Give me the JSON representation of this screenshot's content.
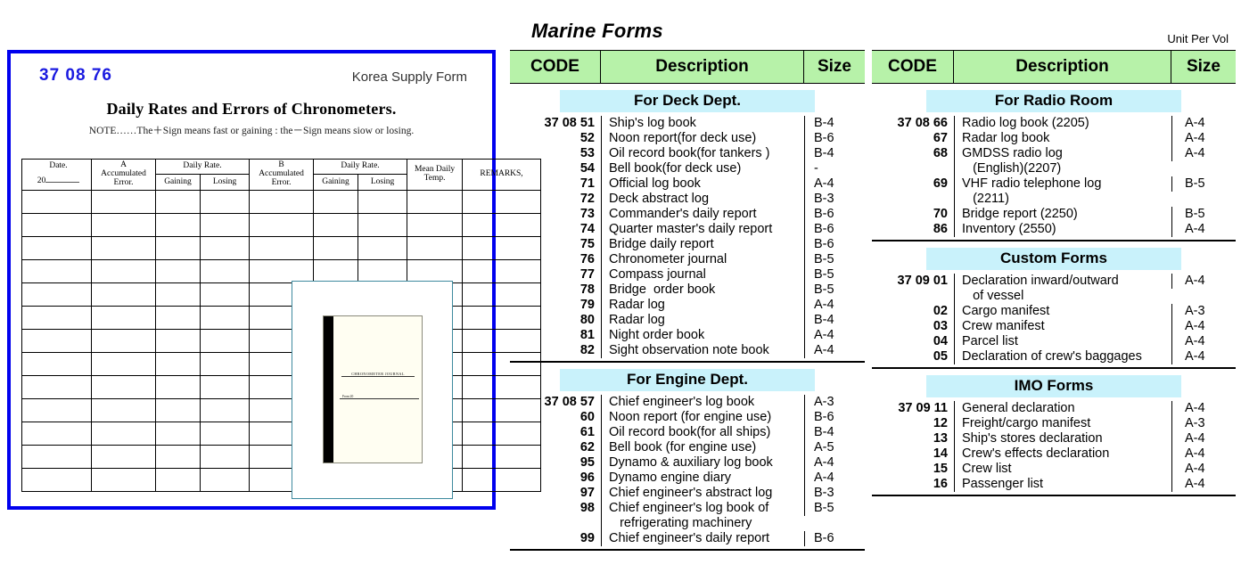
{
  "catalog": {
    "title": "Marine Forms",
    "unit_note": "Unit Per Vol",
    "columns": {
      "code": "CODE",
      "description": "Description",
      "size": "Size"
    },
    "sections": [
      {
        "band": "For Deck Dept.",
        "column": "middle",
        "rows": [
          {
            "code": "37 08 51",
            "description": "Ship's log book",
            "size": "B-4"
          },
          {
            "code": "52",
            "description": "Noon report(for deck use)",
            "size": "B-6"
          },
          {
            "code": "53",
            "description": "Oil record book(for tankers )",
            "size": "B-4"
          },
          {
            "code": "54",
            "description": "Bell book(for deck use)",
            "size": "-"
          },
          {
            "code": "71",
            "description": "Official log book",
            "size": "A-4"
          },
          {
            "code": "72",
            "description": "Deck abstract log",
            "size": "B-3"
          },
          {
            "code": "73",
            "description": "Commander's daily report",
            "size": "B-6"
          },
          {
            "code": "74",
            "description": "Quarter master's daily report",
            "size": "B-6"
          },
          {
            "code": "75",
            "description": "Bridge daily report",
            "size": "B-6"
          },
          {
            "code": "76",
            "description": "Chronometer journal",
            "size": "B-5"
          },
          {
            "code": "77",
            "description": "Compass journal",
            "size": "B-5"
          },
          {
            "code": "78",
            "description": "Bridge  order book",
            "size": "B-5"
          },
          {
            "code": "79",
            "description": "Radar log",
            "size": "A-4"
          },
          {
            "code": "80",
            "description": "Radar log",
            "size": "B-4"
          },
          {
            "code": "81",
            "description": "Night order book",
            "size": "A-4"
          },
          {
            "code": "82",
            "description": "Sight observation note book",
            "size": "A-4"
          }
        ]
      },
      {
        "band": "For Engine Dept.",
        "column": "middle",
        "rows": [
          {
            "code": "37 08 57",
            "description": "Chief engineer's log book",
            "size": "A-3"
          },
          {
            "code": "60",
            "description": "Noon report (for engine use)",
            "size": "B-6"
          },
          {
            "code": "61",
            "description": "Oil record book(for all ships)",
            "size": "B-4"
          },
          {
            "code": "62",
            "description": "Bell book (for engine use)",
            "size": "A-5"
          },
          {
            "code": "95",
            "description": "Dynamo & auxiliary log book",
            "size": "A-4"
          },
          {
            "code": "96",
            "description": "Dynamo engine diary",
            "size": "A-4"
          },
          {
            "code": "97",
            "description": "Chief engineer's abstract log",
            "size": "B-3"
          },
          {
            "code": "98",
            "description": "Chief engineer's log book of\n   refrigerating machinery",
            "size": "B-5"
          },
          {
            "code": "99",
            "description": "Chief engineer's daily report",
            "size": "B-6"
          }
        ]
      },
      {
        "band": "For Radio Room",
        "column": "right",
        "rows": [
          {
            "code": "37 08 66",
            "description": "Radio log book (2205)",
            "size": "A-4"
          },
          {
            "code": "67",
            "description": "Radar log book",
            "size": "A-4"
          },
          {
            "code": "68",
            "description": "GMDSS radio log\n   (English)(2207)",
            "size": "A-4"
          },
          {
            "code": "69",
            "description": "VHF radio telephone log\n   (2211)",
            "size": "B-5"
          },
          {
            "code": "70",
            "description": "Bridge report (2250)",
            "size": "B-5"
          },
          {
            "code": "86",
            "description": "Inventory (2550)",
            "size": "A-4"
          }
        ]
      },
      {
        "band": "Custom Forms",
        "column": "right",
        "rows": [
          {
            "code": "37 09 01",
            "description": "Declaration inward/outward\n   of vessel",
            "size": "A-4"
          },
          {
            "code": "02",
            "description": "Cargo manifest",
            "size": "A-3"
          },
          {
            "code": "03",
            "description": "Crew manifest",
            "size": "A-4"
          },
          {
            "code": "04",
            "description": "Parcel list",
            "size": "A-4"
          },
          {
            "code": "05",
            "description": "Declaration of crew's baggages",
            "size": "A-4"
          }
        ]
      },
      {
        "band": "IMO Forms",
        "column": "right",
        "rows": [
          {
            "code": "37 09 11",
            "description": "General declaration",
            "size": "A-4"
          },
          {
            "code": "12",
            "description": "Freight/cargo manifest",
            "size": "A-3"
          },
          {
            "code": "13",
            "description": "Ship's stores declaration",
            "size": "A-4"
          },
          {
            "code": "14",
            "description": "Crew's effects declaration",
            "size": "A-4"
          },
          {
            "code": "15",
            "description": "Crew list",
            "size": "A-4"
          },
          {
            "code": "16",
            "description": "Passenger list",
            "size": "A-4"
          }
        ]
      }
    ]
  },
  "sample_form": {
    "code": "37 08 76",
    "origin": "Korea Supply Form",
    "title": "Daily Rates and Errors of Chronometers.",
    "note": "NOTE……The＋Sign means fast or gaining : the－Sign means siow or losing.",
    "table": {
      "headers_top": [
        "Date.",
        "A\nAccumulated\nError.",
        "Daily Rate.",
        "B\nAccumulated\nError.",
        "Daily Rate.",
        "Mean Daily\nTemp.",
        "REMARKS,"
      ],
      "date_year_prefix": "20",
      "sub_headers": [
        "Gaining",
        "Losing"
      ],
      "body_rows": 13
    },
    "photo": {
      "caption": "chronometer-journal-book",
      "cover_title": "CHRONOMETER  JOURNAL",
      "cover_line": "From                    20"
    }
  },
  "colors": {
    "header_green": "#b7f2a9",
    "band_cyan": "#c9f2fb",
    "form_border_blue": "#0000ee",
    "form_code_blue": "#1a1ae0",
    "photo_border": "#3e8a9e"
  }
}
